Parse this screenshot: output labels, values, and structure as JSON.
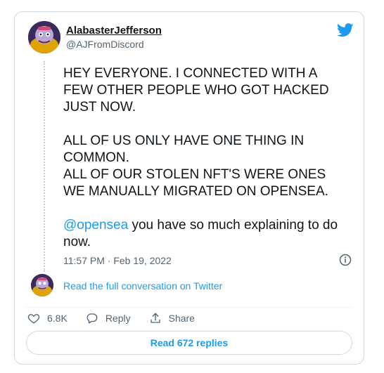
{
  "author": {
    "display_name": "AlabasterJefferson",
    "handle": "@AJFromDiscord",
    "avatar_icon": "cartoon-avatar"
  },
  "tweet": {
    "paragraphs": [
      [
        "HEY EVERYONE. I CONNECTED WITH A FEW OTHER PEOPLE WHO GOT HACKED JUST NOW."
      ],
      [
        "ALL OF US ONLY HAVE ONE THING IN COMMON.",
        "ALL OF OUR STOLEN NFT'S WERE ONES WE MANUALLY MIGRATED ON OPENSEA."
      ]
    ],
    "mention": "@opensea",
    "mention_tail": " you have so much explaining to do now.",
    "timestamp": "11:57 PM · Feb 19, 2022"
  },
  "conversation_link": "Read the full conversation on Twitter",
  "actions": {
    "likes": "6.8K",
    "reply": "Reply",
    "share": "Share"
  },
  "read_replies": "Read 672 replies",
  "colors": {
    "accent": "#1d9bf0",
    "text": "#0f1419",
    "muted": "#536471",
    "border": "#cfd9de"
  },
  "icons": [
    "twitter-bird-icon",
    "info-icon",
    "heart-icon",
    "reply-bubble-icon",
    "share-icon"
  ]
}
